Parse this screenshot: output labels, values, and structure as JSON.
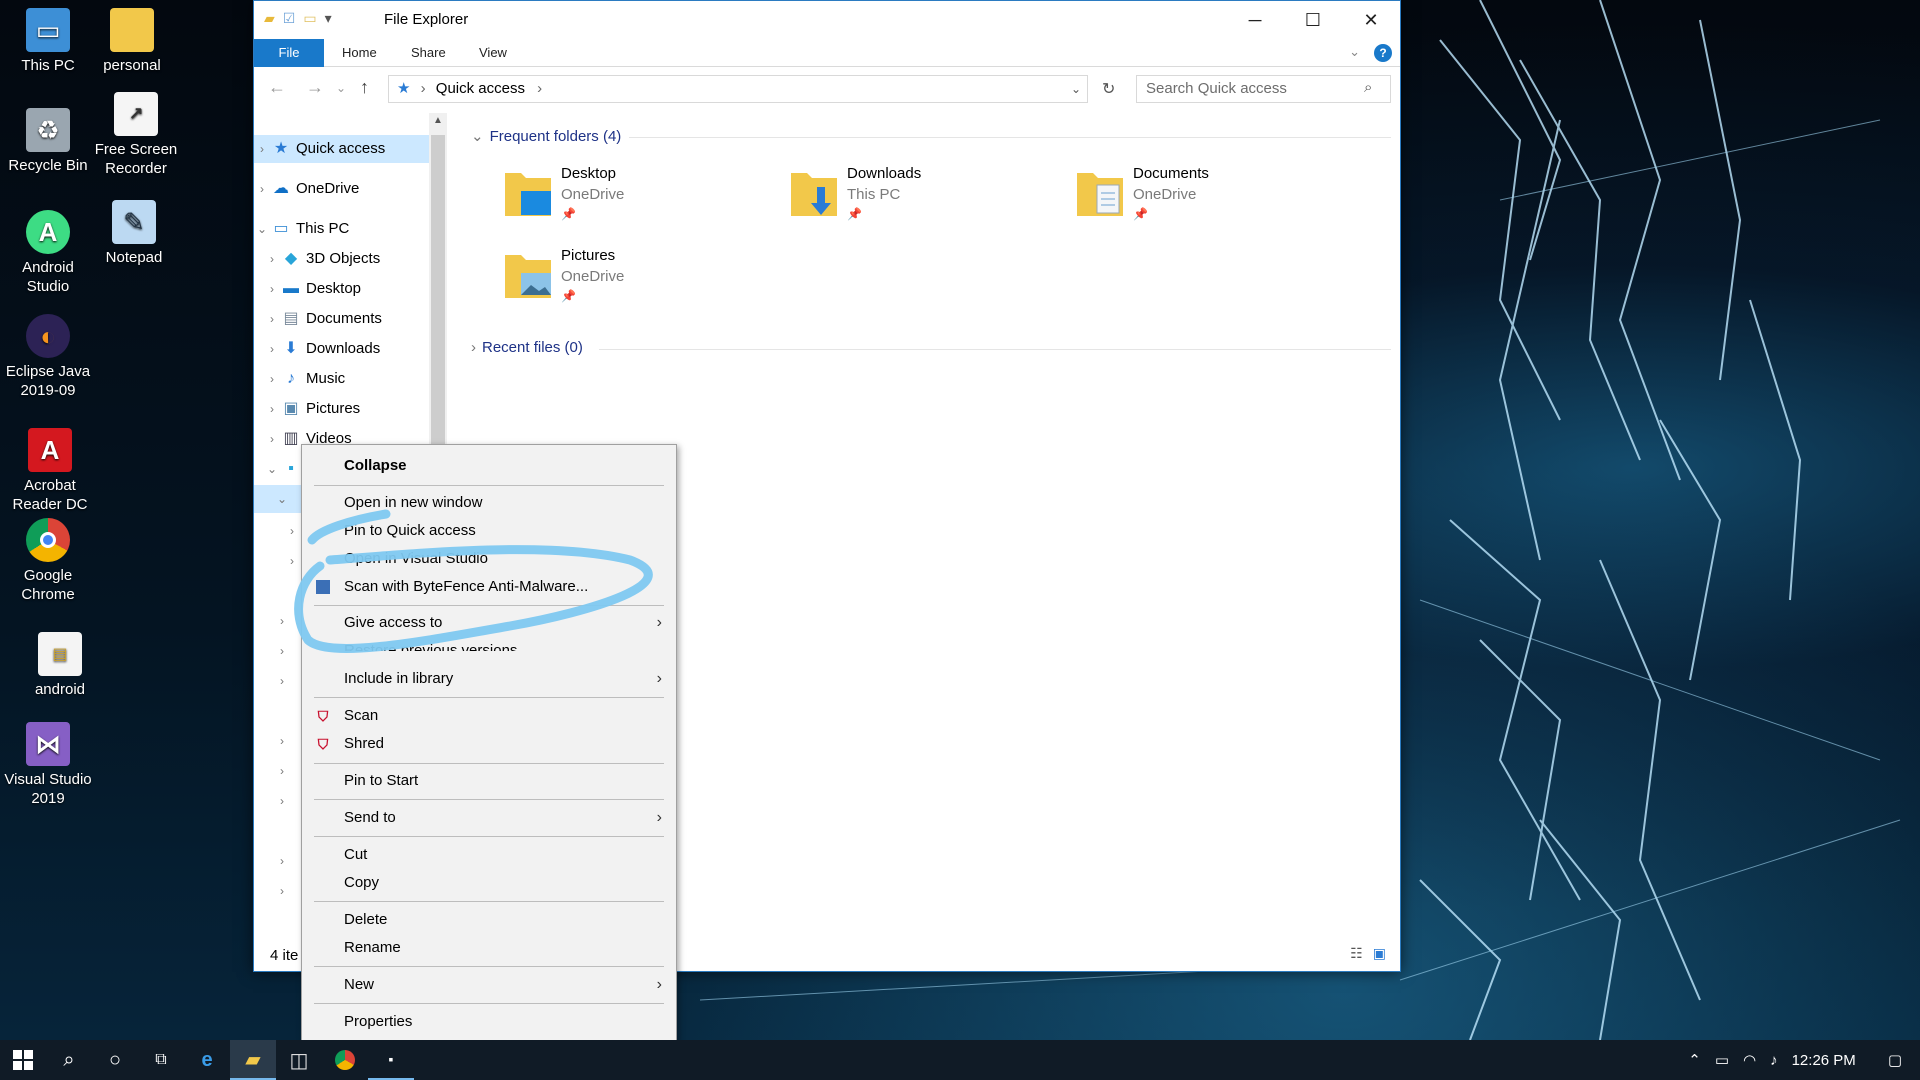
{
  "desktop": {
    "icons": [
      {
        "label": "This PC",
        "icon": "monitor-icon"
      },
      {
        "label": "personal",
        "icon": "folder-icon"
      },
      {
        "label": "Recycle Bin",
        "icon": "recycle-bin-icon"
      },
      {
        "label": "Free Screen Recorder",
        "icon": "file-shortcut-icon"
      },
      {
        "label": "Android Studio",
        "icon": "android-studio-icon"
      },
      {
        "label": "Notepad",
        "icon": "notepad-icon"
      },
      {
        "label": "Eclipse Java 2019-09",
        "icon": "eclipse-icon"
      },
      {
        "label": "Acrobat Reader DC",
        "icon": "acrobat-icon"
      },
      {
        "label": "Google Chrome",
        "icon": "chrome-icon"
      },
      {
        "label": "android",
        "icon": "file-icon"
      },
      {
        "label": "Visual Studio 2019",
        "icon": "visual-studio-icon"
      }
    ]
  },
  "window": {
    "title": "File Explorer",
    "ribbon_tabs": [
      "File",
      "Home",
      "Share",
      "View"
    ],
    "address": {
      "root": "Quick access"
    },
    "search_placeholder": "Search Quick access",
    "nav": {
      "quick_access": "Quick access",
      "onedrive": "OneDrive",
      "this_pc": "This PC",
      "children": [
        "3D Objects",
        "Desktop",
        "Documents",
        "Downloads",
        "Music",
        "Pictures",
        "Videos"
      ]
    },
    "frequent_header": "Frequent folders (4)",
    "recent_header": "Recent files (0)",
    "folders": [
      {
        "name": "Desktop",
        "location": "OneDrive"
      },
      {
        "name": "Downloads",
        "location": "This PC"
      },
      {
        "name": "Documents",
        "location": "OneDrive"
      },
      {
        "name": "Pictures",
        "location": "OneDrive"
      }
    ],
    "status": "4 ite"
  },
  "context_menu": {
    "items": {
      "collapse": "Collapse",
      "open_new_window": "Open in new window",
      "pin_quick_access": "Pin to Quick access",
      "open_in_visual": "Open in Visual Studio",
      "scan_bytefence": "Scan with ByteFence Anti-Malware...",
      "give_access": "Give access to",
      "restore_previous": "Restore previous versions",
      "include_library": "Include in library",
      "scan": "Scan",
      "shred": "Shred",
      "pin_start": "Pin to Start",
      "send_to": "Send to",
      "cut": "Cut",
      "copy": "Copy",
      "delete": "Delete",
      "rename": "Rename",
      "new": "New",
      "properties": "Properties"
    }
  },
  "taskbar": {
    "time": "12:26 PM"
  },
  "colors": {
    "accent": "#1979ca",
    "selection": "#cce8ff",
    "annotation": "#7ec8f0",
    "mcafee_red": "#c8102e"
  }
}
